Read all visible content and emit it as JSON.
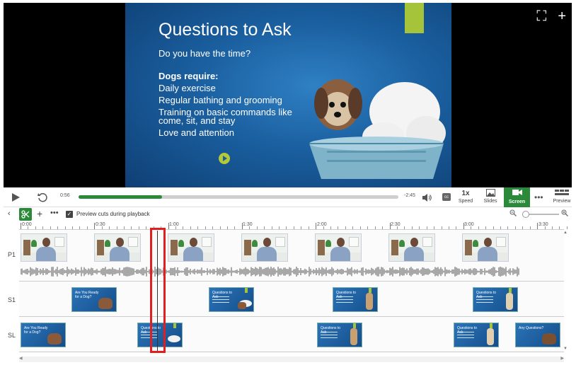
{
  "slide": {
    "title": "Questions to Ask",
    "line1": "Do you have the time?",
    "heading": "Dogs require:",
    "items": [
      "Daily exercise",
      "Regular bathing and grooming",
      "Training on basic commands like",
      "come, sit, and stay",
      "Love and attention"
    ]
  },
  "video_icons": {
    "fullscreen": "⛶",
    "add": "+"
  },
  "controls": {
    "current_time": "0:56",
    "total_time": "-2:45",
    "progress": 0.26,
    "cc": "cc",
    "speed_value": "1x",
    "speed_label": "Speed",
    "slides_label": "Slides",
    "screen_label": "Screen",
    "more": "•••",
    "preview_label": "Preview"
  },
  "toolbar": {
    "back": "‹",
    "add": "+",
    "more": "•••",
    "preview_cuts_label": "Preview cuts during playback",
    "preview_cuts_checked": true
  },
  "ruler": {
    "labels": [
      "0:00",
      "0:30",
      "1:00",
      "1:30",
      "2:00",
      "2:30",
      "3:00",
      "3:30"
    ]
  },
  "tracks": [
    "P1",
    "S1",
    "SL"
  ],
  "slide_thumbs": {
    "s1_titles": [
      "Are You Ready for a Dog?",
      "Questions to Ask",
      "Questions to Ask",
      "Questions to Ask"
    ],
    "sl_titles": [
      "Are You Ready for a Dog?",
      "Questions to Ask",
      "Questions to Ask",
      "Questions to Ask",
      "Any Questions?"
    ]
  }
}
